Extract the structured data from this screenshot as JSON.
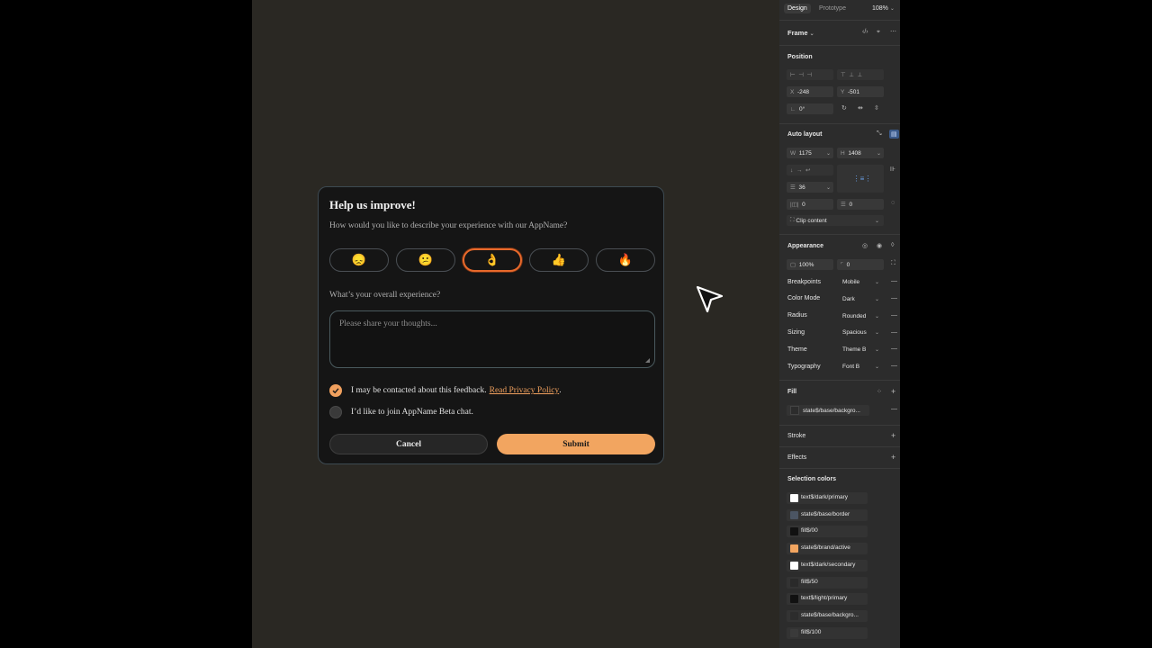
{
  "dialog": {
    "title": "Help us improve!",
    "question": "How would you like to describe your experience with our AppName?",
    "emojis": [
      {
        "glyph": "😞",
        "icon": "disappointed-face-icon"
      },
      {
        "glyph": "😕",
        "icon": "confused-face-icon"
      },
      {
        "glyph": "👌",
        "icon": "ok-hand-icon",
        "selected": true
      },
      {
        "glyph": "👍",
        "icon": "thumbs-up-icon"
      },
      {
        "glyph": "🔥",
        "icon": "fire-icon"
      }
    ],
    "overall_label": "What’s your overall experience?",
    "textarea_placeholder": "Please share your thoughts...",
    "contact_text": "I may be contacted about this feedback.",
    "privacy_link": "Read Privacy Policy",
    "contact_period": ".",
    "beta_text": "I’d like to join AppName Beta chat.",
    "contact_checked": true,
    "beta_checked": false,
    "cancel_label": "Cancel",
    "submit_label": "Submit",
    "accent_color": "#f2a560",
    "selected_border_color": "#e8692b"
  },
  "panel": {
    "tabs": {
      "design": "Design",
      "prototype": "Prototype",
      "zoom": "108%"
    },
    "frame_label": "Frame",
    "position": {
      "title": "Position",
      "x_label": "X",
      "x_value": "-248",
      "y_label": "Y",
      "y_value": "-501",
      "rotation": "0°"
    },
    "auto_layout": {
      "title": "Auto layout",
      "w_label": "W",
      "w_value": "1175",
      "h_label": "H",
      "h_value": "1408",
      "gap": "36",
      "pad_h": "0",
      "pad_v": "0",
      "clip": "Clip content"
    },
    "appearance": {
      "title": "Appearance",
      "opacity": "100%",
      "radius": "0",
      "props": [
        {
          "label": "Breakpoints",
          "value": "Mobile"
        },
        {
          "label": "Color Mode",
          "value": "Dark"
        },
        {
          "label": "Radius",
          "value": "Rounded"
        },
        {
          "label": "Sizing",
          "value": "Spacious"
        },
        {
          "label": "Theme",
          "value": "Theme B"
        },
        {
          "label": "Typography",
          "value": "Font B"
        }
      ]
    },
    "fill": {
      "title": "Fill",
      "value": "state$/base/backgro..."
    },
    "stroke_title": "Stroke",
    "effects_title": "Effects",
    "selection_colors": {
      "title": "Selection colors",
      "items": [
        {
          "label": "text$/dark/primary",
          "color": "#ffffff"
        },
        {
          "label": "state$/base/border",
          "color": "#4b5563"
        },
        {
          "label": "fill$/00",
          "color": "#111111"
        },
        {
          "label": "state$/brand/active",
          "color": "#f2a560"
        },
        {
          "label": "text$/dark/secondary",
          "color": "#ffffff"
        },
        {
          "label": "fill$/50",
          "color": "#2a2a2a"
        },
        {
          "label": "text$/light/primary",
          "color": "#111111"
        },
        {
          "label": "state$/base/backgro...",
          "color": "#2c2c2c"
        },
        {
          "label": "fill$/100",
          "color": "#3a3a3a"
        }
      ]
    }
  }
}
